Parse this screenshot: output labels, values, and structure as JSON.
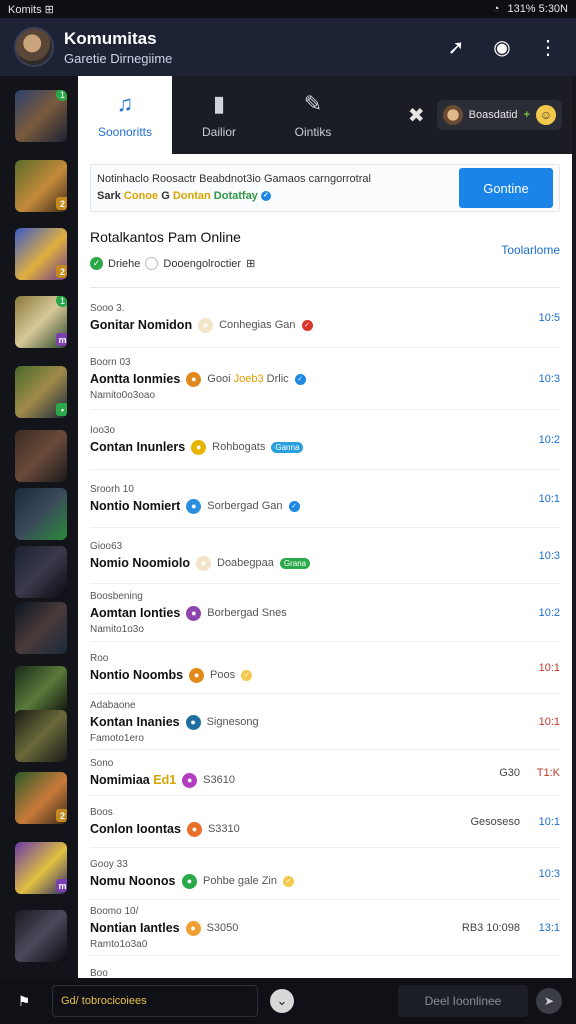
{
  "status_bar": {
    "left": "Komits  ⊞",
    "right": "131%  5:30N"
  },
  "header": {
    "title": "Komumitas",
    "subtitle": "Garetie Dirnegiime"
  },
  "tabs": [
    {
      "label": "Soonoritts",
      "icon": "music-icon",
      "active": true
    },
    {
      "label": "Dailior",
      "icon": "door-icon",
      "active": false
    },
    {
      "label": "Ointiks",
      "icon": "wrench-icon",
      "active": false
    }
  ],
  "user_chip": {
    "name": "Boasdatid",
    "plus": "+"
  },
  "banner": {
    "line1": "Notinhaclo Roosactr Beabdnot3io Gamaos carngorrotral",
    "line2_a": "Sark",
    "line2_b": "Conoe",
    "line2_c": "G",
    "line2_d": "Dontan",
    "line2_e": "Dotatfay",
    "button": "Gontine"
  },
  "section": {
    "title": "Rotalkantos Pam Online",
    "status_a": "Driehe",
    "status_b": "Dooengolroctier",
    "status_b_suffix": "⊞",
    "link": "Toolarlome"
  },
  "rows": [
    {
      "small": "Sooo 3.",
      "name": "Gonitar Nomidon",
      "status": "Conhegias Gan",
      "icon_color": "#f3e6c8",
      "mini_color": "#d9342b",
      "pill": "",
      "sub": "",
      "mid": "",
      "time": "10:5",
      "red": false
    },
    {
      "small": "Boorn 03",
      "name": "Aontta Ionmies",
      "status": "Gooi",
      "status_hl": "Joeb3",
      "status_tail": "Drlic",
      "icon_color": "#e0891a",
      "mini_color": "#1e88e5",
      "pill": "",
      "sub": "Namito0o3oao",
      "mid": "",
      "time": "10:3",
      "red": false
    },
    {
      "small": "Ioo3o",
      "name": "Contan Inunlers",
      "status": "Rohbogats",
      "icon_color": "#e7b400",
      "mini_color": "",
      "pill": "Ganna",
      "pill_color": "#2aa0e0",
      "sub": "",
      "mid": "",
      "time": "10:2",
      "red": false
    },
    {
      "small": "Sroorh 10",
      "name": "Nontio Nomiert",
      "status": "Sorbergad Gan",
      "icon_color": "#2b8fe0",
      "mini_color": "#1e88e5",
      "pill": "",
      "sub": "",
      "mid": "",
      "time": "10:1",
      "red": false
    },
    {
      "small": "Gioo63",
      "name": "Nomio Noomiolo",
      "status": "Doabegpaa",
      "icon_color": "#f3e6c8",
      "mini_color": "",
      "pill": "Grana",
      "pill_color": "#2aa84a",
      "sub": "",
      "mid": "",
      "time": "10:3",
      "red": false
    },
    {
      "small": "Boosbening",
      "name": "Aomtan Ionties",
      "status": "Borbergad Snes",
      "icon_color": "#8e44ad",
      "mini_color": "",
      "pill": "",
      "sub": "Namito1o3o",
      "mid": "",
      "time": "10:2",
      "red": false
    },
    {
      "small": "Roo",
      "name": "Nontio Noombs",
      "status": "Poos",
      "icon_color": "#e08a1a",
      "mini_color": "#f2c94c",
      "pill": "",
      "sub": "",
      "mid": "",
      "time": "10:1",
      "red": true
    },
    {
      "small": "Adabaone",
      "name": "Kontan Inanies",
      "status": "Signesong",
      "icon_color": "#1e6fa0",
      "mini_color": "",
      "pill": "",
      "sub": "Famoto1ero",
      "mid": "",
      "time": "10:1",
      "red": true
    },
    {
      "small": "Sono",
      "name": "Nomimiaa",
      "name_hl": "Ed1",
      "status": "S3610",
      "icon_color": "#b43cc0",
      "mini_color": "",
      "pill": "",
      "sub": "",
      "mid": "G30",
      "time": "T1:K",
      "red": true
    },
    {
      "small": "Boos",
      "name": "Conlon Ioontas",
      "status": "S3310",
      "icon_color": "#e8702a",
      "mini_color": "",
      "pill": "",
      "sub": "",
      "mid": "Gesoseso",
      "time": "10:1",
      "red": false
    },
    {
      "small": "Gooy 33",
      "name": "Nomu Noonos",
      "status": "Pohbe gale Zin",
      "icon_color": "#2aa84a",
      "mini_color": "#f2c94c",
      "pill": "",
      "sub": "",
      "mid": "",
      "time": "10:3",
      "red": false
    },
    {
      "small": "Boomo 10/",
      "name": "Nontian Iantles",
      "status": "S3050",
      "icon_color": "#f0a030",
      "mini_color": "",
      "pill": "",
      "sub": "Ramto1o3a0",
      "mid": "RB3 10:098",
      "time": "13:1",
      "red": false
    },
    {
      "small": "Boo",
      "name": "",
      "status": "",
      "icon_color": "",
      "mini_color": "",
      "pill": "",
      "sub": "",
      "mid": "",
      "time": "",
      "red": false
    }
  ],
  "bottom": {
    "input_text": "Gd/ tobrocicoiees",
    "right_button": "Deel Ioonlinee"
  }
}
